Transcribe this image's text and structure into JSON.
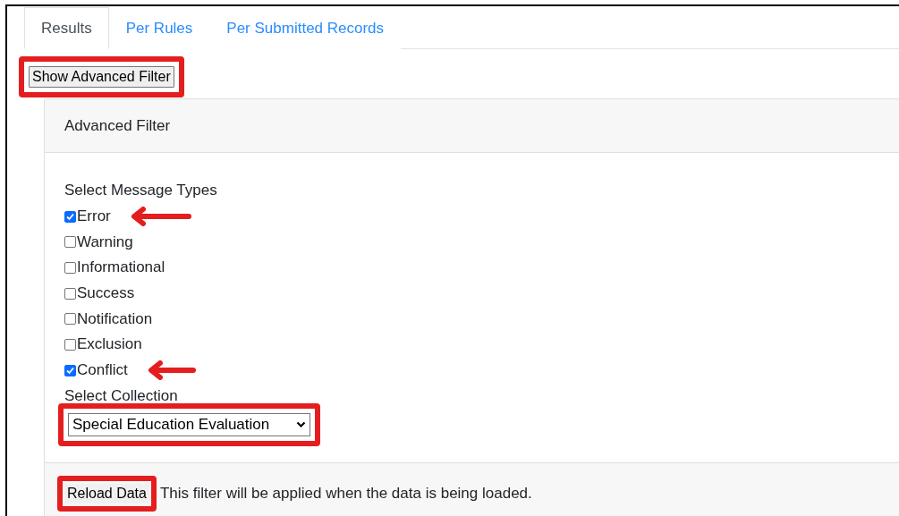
{
  "tabs": [
    {
      "label": "Results",
      "selected": true
    },
    {
      "label": "Per Rules",
      "selected": false
    },
    {
      "label": "Per Submitted Records",
      "selected": false
    }
  ],
  "toggle_button": {
    "label": "Show Advanced Filter",
    "highlighted": true
  },
  "filter_card": {
    "title": "Advanced Filter",
    "message_types_label": "Select Message Types",
    "message_types": [
      {
        "label": "Error",
        "checked": true,
        "arrow": true
      },
      {
        "label": "Warning",
        "checked": false,
        "arrow": false
      },
      {
        "label": "Informational",
        "checked": false,
        "arrow": false
      },
      {
        "label": "Success",
        "checked": false,
        "arrow": false
      },
      {
        "label": "Notification",
        "checked": false,
        "arrow": false
      },
      {
        "label": "Exclusion",
        "checked": false,
        "arrow": false
      },
      {
        "label": "Conflict",
        "checked": true,
        "arrow": true
      }
    ],
    "collection_label": "Select Collection",
    "collection_select": {
      "value": "Special Education Evaluation",
      "highlighted": true
    },
    "reload_button": {
      "label": "Reload Data",
      "highlighted": true
    },
    "footer_note": "This filter will be applied when the data is being loaded."
  }
}
